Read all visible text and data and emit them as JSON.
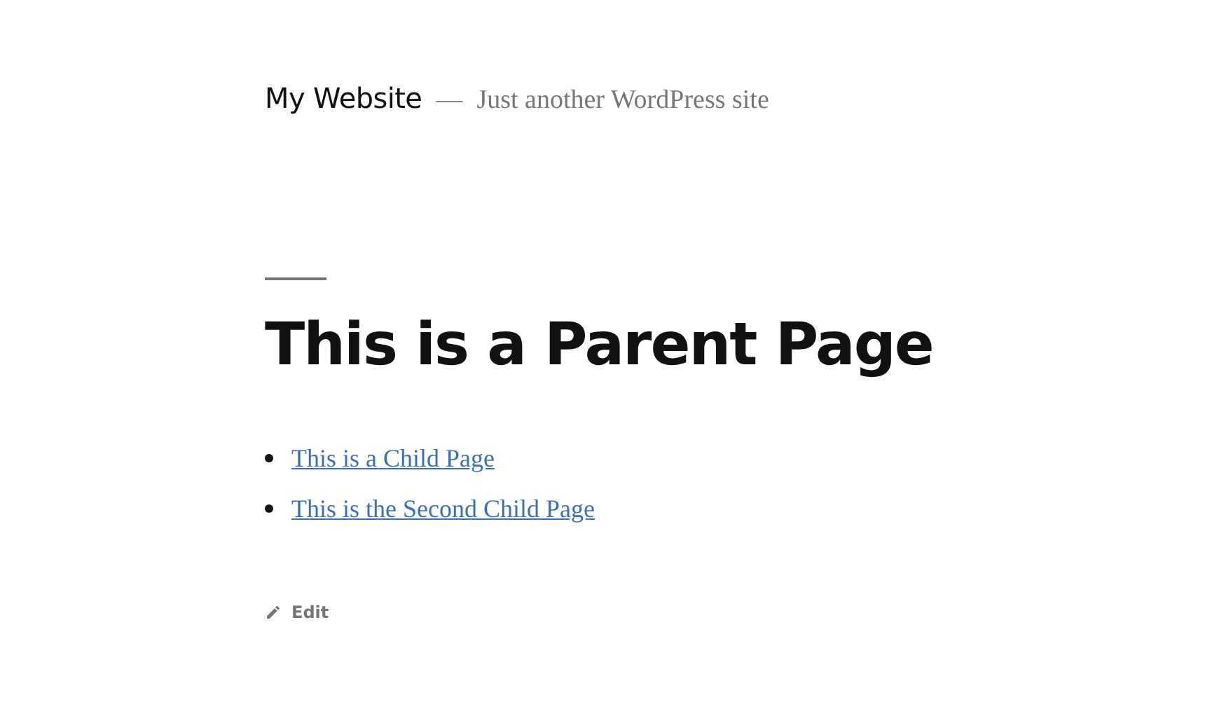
{
  "header": {
    "site_title": "My Website",
    "separator": "—",
    "tagline": "Just another WordPress site"
  },
  "page": {
    "title": "This is a Parent Page",
    "child_pages": [
      {
        "label": "This is a Child Page"
      },
      {
        "label": "This is the Second Child Page"
      }
    ],
    "edit_link": "Edit"
  }
}
